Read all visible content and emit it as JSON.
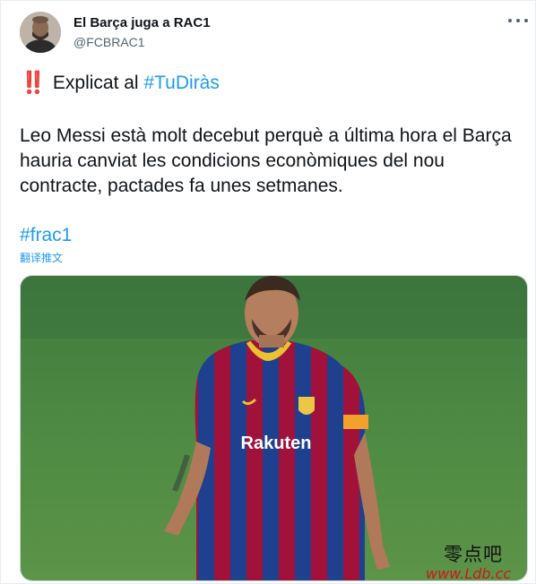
{
  "tweet": {
    "author_name": "El Barça juga a RAC1",
    "author_handle": "@FCBRAC1",
    "more_icon": "more-horizontal-icon",
    "line1_emoji": "‼️",
    "line1_text": "Explicat al",
    "line1_hashtag": "#TuDiràs",
    "body": "Leo Messi està molt decebut perquè a última hora el Barça hauria canviat les condicions econòmiques del nou contracte, pactades fa unes setmanes.",
    "hashtag": "#frac1",
    "translate_link": "翻译推文",
    "media_jersey_text": "Rakuten"
  },
  "watermark": {
    "chinese": "零点吧",
    "url": "www.Ldb.cc"
  },
  "colors": {
    "link": "#1d9bf0",
    "text": "#0f1419",
    "secondary": "#536471",
    "exclamation": "#e0245e"
  }
}
